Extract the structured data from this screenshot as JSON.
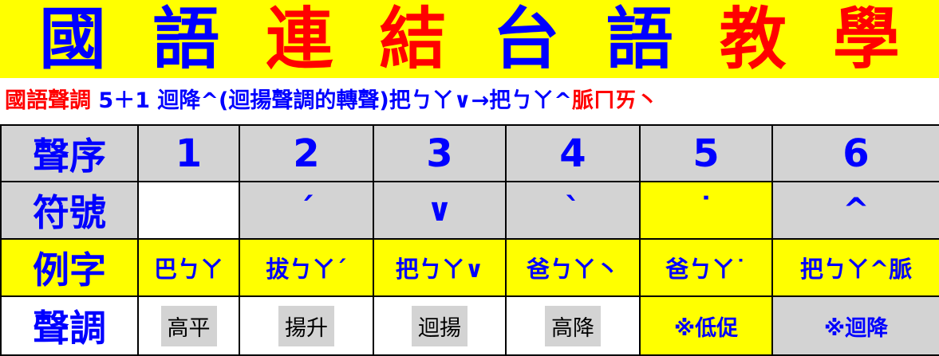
{
  "title": {
    "chars": [
      {
        "text": "國",
        "color": "#0000ff"
      },
      {
        "text": "語",
        "color": "#0000ff"
      },
      {
        "text": "連",
        "color": "#ff0000"
      },
      {
        "text": "結",
        "color": "#ff0000"
      },
      {
        "text": "台",
        "color": "#0000ff"
      },
      {
        "text": "語",
        "color": "#0000ff"
      },
      {
        "text": "教",
        "color": "#ff0000"
      },
      {
        "text": "學",
        "color": "#ff0000"
      }
    ]
  },
  "subtitle": {
    "p1": "國語聲調",
    "p2": "5＋1",
    "p3": "迴降^(迴揚聲調的轉聲)把ㄅㄚ∨→把ㄅㄚ^",
    "p4": "脈ㄇㄞ丶"
  },
  "table": {
    "row_labels": [
      "聲序",
      "符號",
      "例字",
      "聲調"
    ],
    "numbers": [
      "1",
      "2",
      "3",
      "4",
      "5",
      "6"
    ],
    "symbols": [
      "",
      "ˊ",
      "∨",
      "ˋ",
      "˙",
      "^"
    ],
    "examples": [
      "巴ㄅㄚ",
      "拔ㄅㄚˊ",
      "把ㄅㄚ∨",
      "爸ㄅㄚ丶",
      "爸ㄅㄚ˙",
      "把ㄅㄚ^脈"
    ],
    "tones": [
      "高平",
      "揚升",
      "迴揚",
      "高降",
      "※低促",
      "※迴降"
    ]
  },
  "colors": {
    "accent_yellow": "#ffff00",
    "blue": "#0000ff",
    "red": "#ff0000",
    "gray": "#d3d3d3"
  }
}
